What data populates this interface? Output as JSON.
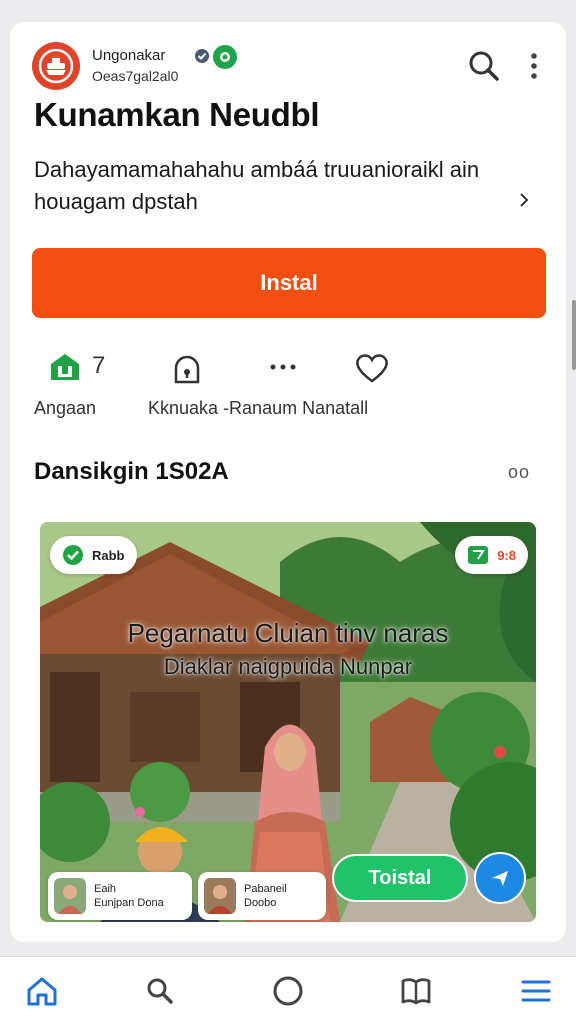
{
  "developer": {
    "name": "Ungonakar",
    "subtitle": "Oeas7gal2al0"
  },
  "app": {
    "title": "Kunamkan Neudbl",
    "description": "Dahayamamahahahu ambáá truuanioraikl ain houagam dpstah",
    "install_label": "Instal"
  },
  "stats": [
    {
      "icon": "rating-icon",
      "value": "7",
      "label": "Angaan"
    },
    {
      "icon": "lock-icon",
      "value": "",
      "label": "Kknuaka -Ranaum Nanatall"
    },
    {
      "icon": "more-dots-icon",
      "value": "",
      "label": ""
    },
    {
      "icon": "heart-icon",
      "value": "",
      "label": ""
    }
  ],
  "section": {
    "title": "Dansikgin 1S02A",
    "more_label": "oo"
  },
  "screenshot": {
    "overlay_line1": "Pegarnatu Cluian tinv naras",
    "overlay_line2": "Diaklar naigpuida Nunpar",
    "chip_left": "Rabb",
    "chip_right": "9:8",
    "card1_line1": "Eaih",
    "card1_line2": "Eunjpan Dona",
    "card2_line1": "Pabaneil",
    "card2_line2": "Doobo",
    "total_label": "Toistal"
  },
  "colors": {
    "accent": "#f24e12",
    "green": "#20c36a",
    "blue": "#1e88e5",
    "nav_active": "#1e6fd9"
  },
  "nav": [
    {
      "icon": "home-icon"
    },
    {
      "icon": "search-icon"
    },
    {
      "icon": "circle-icon"
    },
    {
      "icon": "book-icon"
    },
    {
      "icon": "menu-icon"
    }
  ]
}
